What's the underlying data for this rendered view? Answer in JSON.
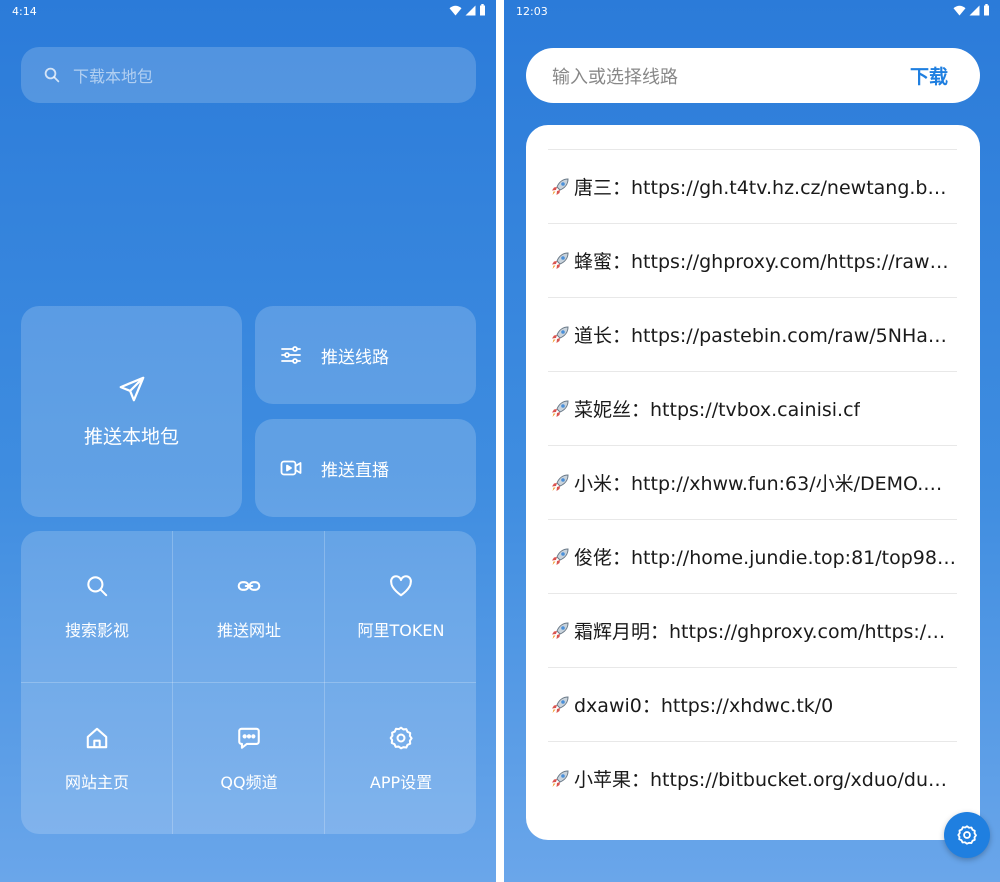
{
  "left": {
    "status": {
      "time": "4:14"
    },
    "search": {
      "placeholder": "下载本地包",
      "icon": "search-icon"
    },
    "tiles": {
      "push_package": {
        "label": "推送本地包",
        "icon": "send-icon"
      },
      "push_route": {
        "label": "推送线路",
        "icon": "sliders-icon"
      },
      "push_live": {
        "label": "推送直播",
        "icon": "video-icon"
      }
    },
    "grid": [
      {
        "label": "搜索影视",
        "icon": "search-icon"
      },
      {
        "label": "推送网址",
        "icon": "link-icon"
      },
      {
        "label": "阿里TOKEN",
        "icon": "heart-icon"
      },
      {
        "label": "网站主页",
        "icon": "home-icon"
      },
      {
        "label": "QQ频道",
        "icon": "chat-icon"
      },
      {
        "label": "APP设置",
        "icon": "gear-icon"
      }
    ]
  },
  "right": {
    "status": {
      "time": "12:03"
    },
    "route_input": {
      "placeholder": "输入或选择线路"
    },
    "download_label": "下载",
    "routes": [
      "唐三：https://gh.t4tv.hz.cz/newtang.b…",
      "蜂蜜：https://ghproxy.com/https://raw…",
      "道长：https://pastebin.com/raw/5NHa…",
      "菜妮丝：https://tvbox.cainisi.cf",
      "小米：http://xhww.fun:63/小米/DEMO.…",
      "俊佬：http://home.jundie.top:81/top98…",
      "霜辉月明：https://ghproxy.com/https:/…",
      "dxawi0：https://xhdwc.tk/0",
      "小苹果：https://bitbucket.org/xduo/du…"
    ],
    "fab_icon": "gear-icon"
  },
  "colors": {
    "accent": "#1f7fe0",
    "background_top": "#2b7bd9",
    "background_bottom": "#6aa6ea"
  }
}
